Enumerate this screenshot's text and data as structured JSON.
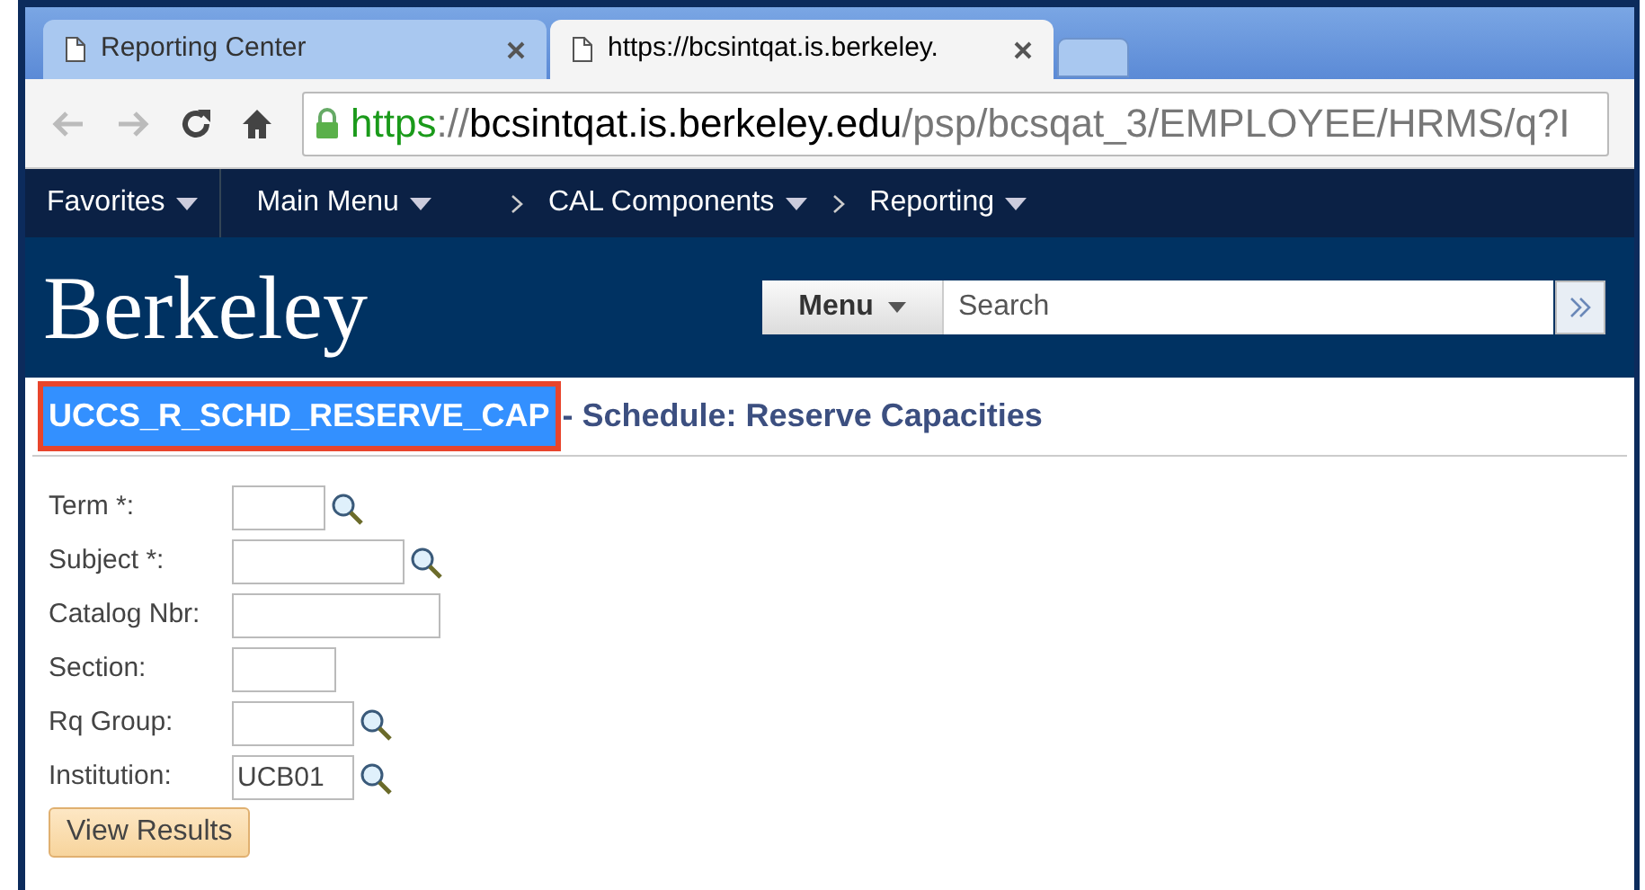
{
  "browser": {
    "tabs": [
      {
        "title": "Reporting Center",
        "selected": false
      },
      {
        "title": "https://bcsintqat.is.berkeley.",
        "selected": true
      }
    ],
    "address": {
      "scheme": "https",
      "separator": "://",
      "host": "bcsintqat.is.berkeley.edu",
      "path": "/psp/bcsqat_3/EMPLOYEE/HRMS/q?I",
      "secure": true
    }
  },
  "nav": {
    "items": [
      {
        "label": "Favorites",
        "breadcrumb": false
      },
      {
        "label": "Main Menu",
        "breadcrumb": false
      },
      {
        "label": "CAL Components",
        "breadcrumb": true
      },
      {
        "label": "Reporting",
        "breadcrumb": true
      }
    ]
  },
  "header": {
    "logo": "Berkeley",
    "menu_button": "Menu",
    "search": {
      "placeholder": "Search"
    }
  },
  "page_title": {
    "code": "UCCS_R_SCHD_RESERVE_CAP",
    "code_selected": true,
    "code_annotated": true,
    "separator": "-",
    "title": "Schedule: Reserve Capacities"
  },
  "form": {
    "fields": [
      {
        "kind": "lookup",
        "label": "Term *:"
      },
      {
        "kind": "lookup",
        "label": "Subject *:"
      },
      {
        "kind": "plain",
        "label": "Catalog Nbr:"
      },
      {
        "kind": "plain",
        "label": "Section:"
      },
      {
        "kind": "lookup",
        "label": "Rq Group:"
      },
      {
        "kind": "lookup",
        "label": "Institution:",
        "value": "UCB01"
      }
    ],
    "button": "View Results"
  }
}
